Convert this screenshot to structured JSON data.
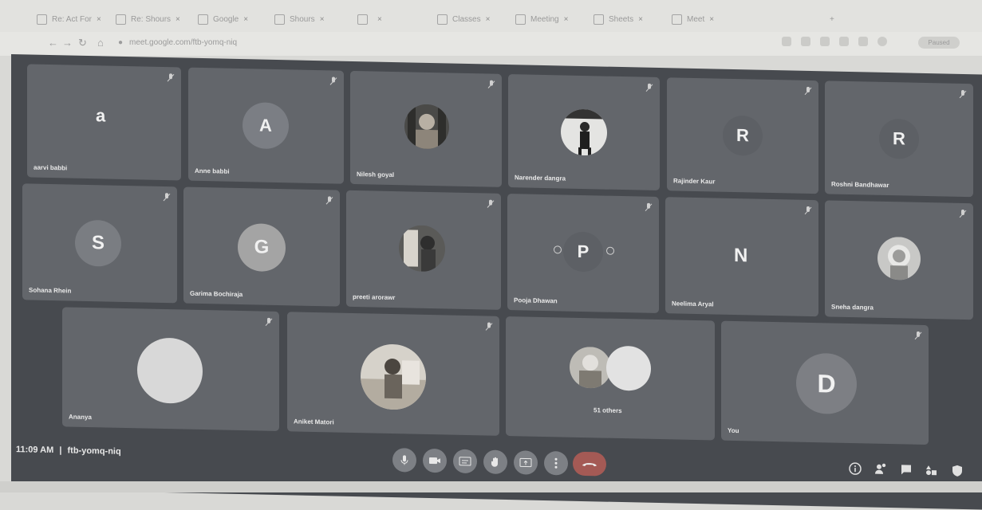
{
  "browser": {
    "tabs": [
      {
        "label": "Re: Act For"
      },
      {
        "label": "Re: Shours"
      },
      {
        "label": "Google"
      },
      {
        "label": "Shours"
      },
      {
        "label": ""
      },
      {
        "label": "Classes"
      },
      {
        "label": "Meeting"
      },
      {
        "label": "Sheets"
      },
      {
        "label": "Meet"
      }
    ],
    "url": "meet.google.com/ftb-yomq-niq",
    "profile_label": "Paused"
  },
  "participants": [
    {
      "name": "aarvi babbi",
      "initial": "a",
      "kind": "letter"
    },
    {
      "name": "Anne babbi",
      "initial": "A",
      "kind": "circle",
      "circle_color": "#7b7e84"
    },
    {
      "name": "Nilesh goyal",
      "kind": "photo"
    },
    {
      "name": "Narender dangra",
      "kind": "photo"
    },
    {
      "name": "Rajinder Kaur",
      "initial": "R",
      "kind": "circle",
      "circle_color": "#5d6065"
    },
    {
      "name": "Roshni Bandhawar",
      "initial": "R",
      "kind": "circle",
      "circle_color": "#5d6065"
    },
    {
      "name": "Sohana Rhein",
      "initial": "S",
      "kind": "circle",
      "circle_color": "#7a7d82"
    },
    {
      "name": "Garima Bochiraja",
      "initial": "G",
      "kind": "circle",
      "circle_color": "#a4a4a4"
    },
    {
      "name": "preeti arorawr",
      "kind": "photo"
    },
    {
      "name": "Pooja Dhawan",
      "initial": "P",
      "kind": "circle",
      "circle_color": "#5d6065"
    },
    {
      "name": "Neelima Aryal",
      "initial": "N",
      "kind": "letter"
    },
    {
      "name": "Sneha dangra",
      "kind": "photo"
    },
    {
      "name": "Ananya",
      "kind": "blank",
      "circle_color": "#d8d8d8"
    },
    {
      "name": "Aniket Matori",
      "kind": "photo"
    },
    {
      "name": "51 others",
      "kind": "group"
    },
    {
      "name": "You",
      "initial": "D",
      "kind": "circle",
      "circle_color": "#7d7f84"
    }
  ],
  "meeting": {
    "time": "11:09 AM",
    "separator": "|",
    "code": "ftb-yomq-niq"
  },
  "controls": [
    {
      "name": "microphone",
      "icon": "mic-icon"
    },
    {
      "name": "camera",
      "icon": "camera-icon"
    },
    {
      "name": "captions",
      "icon": "captions-icon"
    },
    {
      "name": "raise-hand",
      "icon": "hand-icon"
    },
    {
      "name": "present",
      "icon": "present-icon"
    },
    {
      "name": "more-options",
      "icon": "more-vert-icon"
    },
    {
      "name": "end-call",
      "icon": "phone-end-icon"
    }
  ],
  "right_controls": [
    {
      "name": "info",
      "icon": "info-icon"
    },
    {
      "name": "people",
      "icon": "people-icon"
    },
    {
      "name": "chat",
      "icon": "chat-icon"
    },
    {
      "name": "activities",
      "icon": "shapes-icon"
    },
    {
      "name": "host-controls",
      "icon": "lock-shield-icon"
    }
  ],
  "colors": {
    "stage_bg": "#474a4f",
    "tile_bg": "#63666b",
    "end_call": "#a45a55"
  }
}
